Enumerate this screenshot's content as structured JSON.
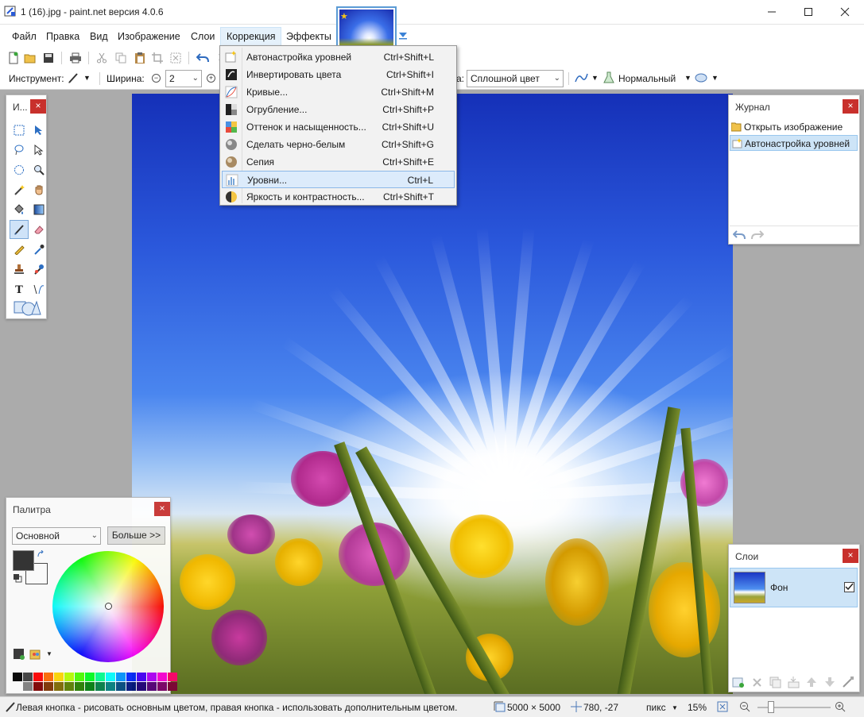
{
  "window": {
    "title": "1 (16).jpg - paint.net версия 4.0.6"
  },
  "menu": {
    "items": [
      "Файл",
      "Правка",
      "Вид",
      "Изображение",
      "Слои",
      "Коррекция",
      "Эффекты"
    ],
    "active": "Коррекция"
  },
  "toolbar": {
    "tool_label": "Инструмент:",
    "width_label": "Ширина:",
    "width_value": "2",
    "fill_label_fragment": "a:",
    "fill_value": "Сплошной цвет",
    "blend_value": "Нормальный"
  },
  "correction_menu": {
    "items": [
      {
        "label": "Автонастройка уровней",
        "shortcut": "Ctrl+Shift+L",
        "icon": "auto-level-icon"
      },
      {
        "label": "Инвертировать цвета",
        "shortcut": "Ctrl+Shift+I",
        "icon": "invert-colors-icon"
      },
      {
        "label": "Кривые...",
        "shortcut": "Ctrl+Shift+M",
        "icon": "curves-icon"
      },
      {
        "label": "Огрубление...",
        "shortcut": "Ctrl+Shift+P",
        "icon": "posterize-icon"
      },
      {
        "label": "Оттенок и насыщенность...",
        "shortcut": "Ctrl+Shift+U",
        "icon": "hue-saturation-icon"
      },
      {
        "label": "Сделать черно-белым",
        "shortcut": "Ctrl+Shift+G",
        "icon": "black-white-icon"
      },
      {
        "label": "Сепия",
        "shortcut": "Ctrl+Shift+E",
        "icon": "sepia-icon"
      },
      {
        "label": "Уровни...",
        "shortcut": "Ctrl+L",
        "icon": "levels-icon"
      },
      {
        "label": "Яркость и контрастность...",
        "shortcut": "Ctrl+Shift+T",
        "icon": "brightness-contrast-icon"
      }
    ],
    "highlighted_index": 7
  },
  "tools_panel": {
    "title": "И..."
  },
  "journal": {
    "title": "Журнал",
    "items": [
      "Открыть изображение",
      "Автонастройка уровней"
    ],
    "selected_index": 1
  },
  "layers": {
    "title": "Слои",
    "items": [
      {
        "name": "Фон",
        "visible": true
      }
    ]
  },
  "palette": {
    "title": "Палитра",
    "mode": "Основной",
    "more_button": "Больше >>",
    "primary_color": "#2b2b2b",
    "secondary_color": "#ffffff",
    "colors": [
      "#000000",
      "#404040",
      "#ff0000",
      "#ff6a00",
      "#ffd800",
      "#b6ff00",
      "#4cff00",
      "#00ff21",
      "#00ff90",
      "#00ffff",
      "#0094ff",
      "#0026ff",
      "#4800ff",
      "#b200ff",
      "#ff00dc",
      "#ff006e",
      "#ffffff",
      "#808080",
      "#7f0000",
      "#7f3300",
      "#7f6a00",
      "#5b7f00",
      "#267f00",
      "#007f0e",
      "#007f46",
      "#007f7f",
      "#004a7f",
      "#00137f",
      "#21007f",
      "#57007f",
      "#7f006e",
      "#7f0037"
    ]
  },
  "statusbar": {
    "hint": "Левая кнопка - рисовать основным цветом, правая кнопка - использовать дополнительным цветом.",
    "image_size": "5000 × 5000",
    "cursor_pos": "780, -27",
    "units": "пикс",
    "zoom": "15%"
  },
  "colors": {
    "menu_highlight": "#dcebfb",
    "selection_blue": "#cde4f7",
    "close_red": "#c8302c"
  }
}
